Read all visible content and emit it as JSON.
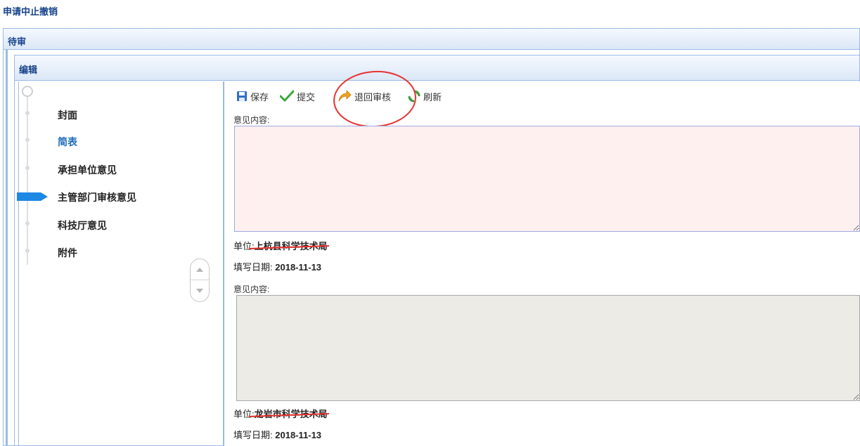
{
  "page": {
    "title": "申请中止撤销"
  },
  "panels": {
    "outer_title": "待审",
    "inner_title": "编辑"
  },
  "nav": {
    "items": [
      {
        "label": "封面",
        "state": "normal"
      },
      {
        "label": "简表",
        "state": "link"
      },
      {
        "label": "承担单位意见",
        "state": "normal"
      },
      {
        "label": "主管部门审核意见",
        "state": "current"
      },
      {
        "label": "科技厅意见",
        "state": "normal"
      },
      {
        "label": "附件",
        "state": "normal"
      }
    ]
  },
  "toolbar": {
    "save_label": "保存",
    "submit_label": "提交",
    "return_label": "退回审核",
    "refresh_label": "刷新"
  },
  "opinions": [
    {
      "content_label": "意见内容:",
      "content_value": "",
      "unit_label": "单位:",
      "unit_value": "上杭县科学技术局",
      "date_label": "填写日期:",
      "date_value": "2018-11-13"
    },
    {
      "content_label": "意见内容:",
      "content_value": "",
      "unit_label": "单位:",
      "unit_value": "龙岩市科学技术局",
      "date_label": "填写日期:",
      "date_value": "2018-11-13"
    }
  ],
  "colors": {
    "panel_border": "#99bbe8",
    "title_blue": "#15428b",
    "link_blue": "#1e6bb8",
    "current_marker": "#1e88e5",
    "annotation_red": "#e8322f"
  },
  "icons": {
    "save": "floppy-disk-icon",
    "submit": "checkmark-icon",
    "return": "return-arrow-icon",
    "refresh": "refresh-icon",
    "scroll_up": "chevron-up-icon",
    "scroll_down": "chevron-down-icon"
  }
}
